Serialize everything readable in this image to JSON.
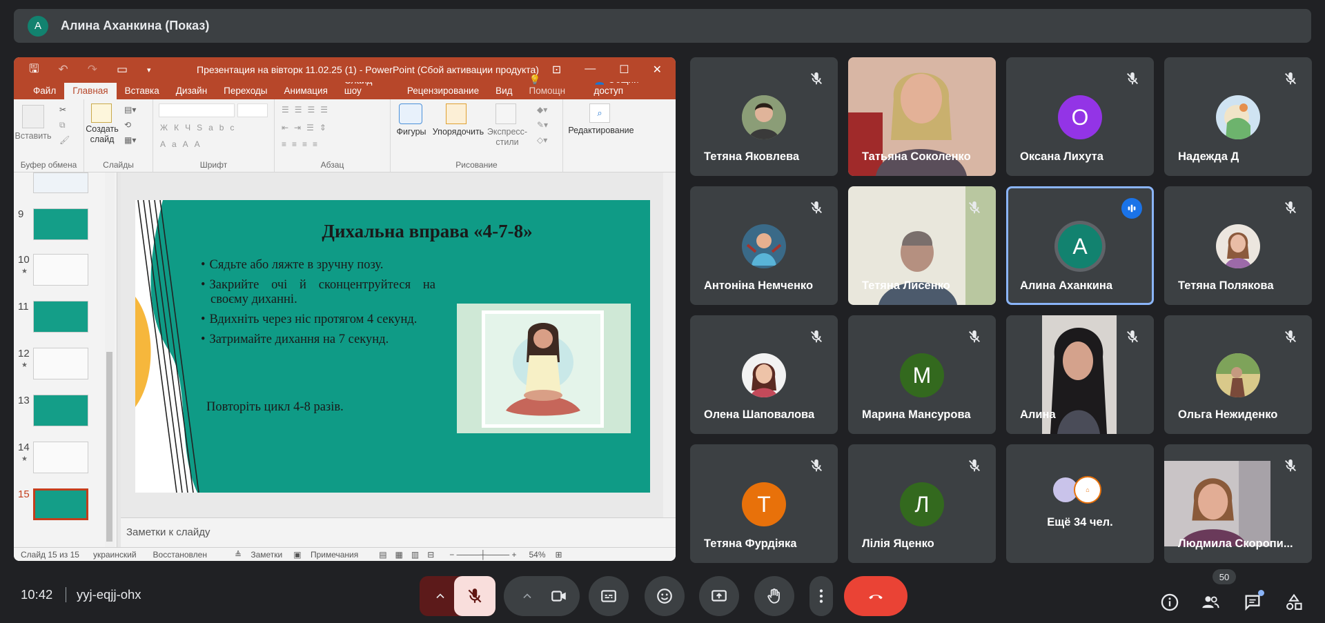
{
  "presenter_banner": {
    "initial": "А",
    "name": "Алина Аханкина (Показ)"
  },
  "powerpoint": {
    "window_title": "Презентация на вівторк 11.02.25 (1) - PowerPoint (Сбой активации продукта)",
    "menu": [
      "Файл",
      "Главная",
      "Вставка",
      "Дизайн",
      "Переходы",
      "Анимация",
      "Слайд-шоу",
      "Рецензирование",
      "Вид",
      "Помощн",
      "Общий доступ"
    ],
    "active_menu": "Главная",
    "ribbon": {
      "paste": "Вставить",
      "new_slide_1": "Создать",
      "new_slide_2": "слайд",
      "shapes": "Фигуры",
      "arrange": "Упорядочить",
      "quick_styles_1": "Экспресс-",
      "quick_styles_2": "стили",
      "editing": "Редактирование",
      "groups": [
        "Буфер обмена",
        "Слайды",
        "Шрифт",
        "Абзац",
        "Рисование"
      ]
    },
    "thumbnails": [
      "9",
      "10",
      "11",
      "12",
      "13",
      "14",
      "15"
    ],
    "slide": {
      "title": "Дихальна вправа «4-7-8»",
      "bullets": [
        "Сядьте або ляжте в зручну позу.",
        "Закрийте очі й сконцентруйтеся на своєму диханні.",
        "Вдихніть через ніс протягом 4 секунд.",
        "Затримайте дихання на 7 секунд."
      ],
      "footer": "Повторіть цикл 4-8 разів."
    },
    "notes_placeholder": "Заметки к слайду",
    "status": {
      "slide": "Слайд 15 из 15",
      "language": "украинский",
      "recovered": "Восстановлен",
      "notes": "Заметки",
      "comments": "Примечания",
      "zoom": "54%"
    }
  },
  "participants": [
    {
      "name": "Тетяна Яковлева",
      "kind": "photo",
      "muted": true
    },
    {
      "name": "Татьяна Соколенко",
      "kind": "video",
      "muted": false
    },
    {
      "name": "Оксана Лихута",
      "kind": "letter",
      "letter": "О",
      "color": "#9334e6",
      "muted": true
    },
    {
      "name": "Надежда Д",
      "kind": "photo",
      "muted": true
    },
    {
      "name": "Антоніна Немченко",
      "kind": "photo",
      "muted": true
    },
    {
      "name": "Тетяна Лисенко",
      "kind": "video",
      "muted": true
    },
    {
      "name": "Алина Аханкина",
      "kind": "letter",
      "letter": "А",
      "color": "#12826f",
      "muted": false,
      "speaking": true
    },
    {
      "name": "Тетяна Полякова",
      "kind": "photo",
      "muted": true
    },
    {
      "name": "Олена Шаповалова",
      "kind": "photo",
      "muted": true
    },
    {
      "name": "Марина Мансурова",
      "kind": "letter",
      "letter": "М",
      "color": "#33691e",
      "muted": true
    },
    {
      "name": "Алина",
      "kind": "video",
      "muted": true
    },
    {
      "name": "Ольга Нежиденко",
      "kind": "photo",
      "muted": true
    },
    {
      "name": "Тетяна Фурдіяка",
      "kind": "letter",
      "letter": "Т",
      "color": "#e8710a",
      "muted": true
    },
    {
      "name": "Лілія Яценко",
      "kind": "letter",
      "letter": "Л",
      "color": "#33691e",
      "muted": true
    },
    {
      "name": "Ещё 34 чел.",
      "kind": "more",
      "muted": false
    },
    {
      "name": "Людмила Скоропи...",
      "kind": "video",
      "muted": true
    }
  ],
  "bottom": {
    "time": "10:42",
    "meeting_code": "yyj-eqjj-ohx",
    "people_count": "50"
  },
  "colors": {
    "background": "#202124",
    "tile": "#3c4043",
    "end_call": "#ea4335",
    "mic_off": "#f9dedc",
    "ppt_red": "#b7472a",
    "slide_teal": "#0f9b86"
  }
}
